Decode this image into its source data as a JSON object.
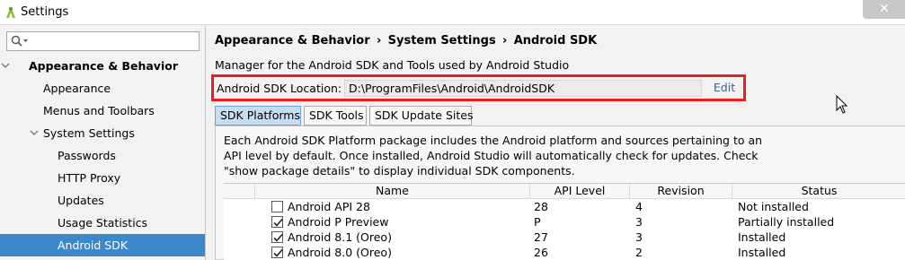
{
  "window": {
    "title": "Settings",
    "close_glyph": "✕"
  },
  "sidebar": {
    "search_placeholder": "",
    "items": [
      {
        "label": "Appearance & Behavior",
        "level": 0,
        "expanded": true,
        "selected": false
      },
      {
        "label": "Appearance",
        "level": 1,
        "selected": false
      },
      {
        "label": "Menus and Toolbars",
        "level": 1,
        "selected": false
      },
      {
        "label": "System Settings",
        "level": 1,
        "expanded": true,
        "selected": false
      },
      {
        "label": "Passwords",
        "level": 2,
        "selected": false
      },
      {
        "label": "HTTP Proxy",
        "level": 2,
        "selected": false
      },
      {
        "label": "Updates",
        "level": 2,
        "selected": false
      },
      {
        "label": "Usage Statistics",
        "level": 2,
        "selected": false
      },
      {
        "label": "Android SDK",
        "level": 2,
        "selected": true
      }
    ]
  },
  "breadcrumb": [
    "Appearance & Behavior",
    "System Settings",
    "Android SDK"
  ],
  "breadcrumb_separator": "›",
  "description": "Manager for the Android SDK and Tools used by Android Studio",
  "sdk_location": {
    "label": "Android SDK Location:",
    "value": "D:\\ProgramFiles\\Android\\AndroidSDK",
    "edit_label": "Edit",
    "highlight_color": "#ee1c1c"
  },
  "tabs": [
    {
      "label": "SDK Platforms",
      "active": true
    },
    {
      "label": "SDK Tools",
      "active": false
    },
    {
      "label": "SDK Update Sites",
      "active": false
    }
  ],
  "panel_text": "Each Android SDK Platform package includes the Android platform and sources pertaining to an API level by default. Once installed, Android Studio will automatically check for updates. Check \"show package details\" to display individual SDK components.",
  "table": {
    "columns": [
      "Name",
      "API Level",
      "Revision",
      "Status"
    ],
    "rows": [
      {
        "checked": false,
        "name": "Android API 28",
        "api_level": "28",
        "revision": "4",
        "status": "Not installed"
      },
      {
        "checked": true,
        "name": "Android P Preview",
        "api_level": "P",
        "revision": "3",
        "status": "Partially installed"
      },
      {
        "checked": true,
        "name": "Android 8.1 (Oreo)",
        "api_level": "27",
        "revision": "3",
        "status": "Installed"
      },
      {
        "checked": true,
        "name": "Android 8.0 (Oreo)",
        "api_level": "26",
        "revision": "2",
        "status": "Installed"
      }
    ]
  },
  "colors": {
    "selection": "#3d88c8",
    "active_tab": "#c7ddf2",
    "link": "#2469b3"
  }
}
